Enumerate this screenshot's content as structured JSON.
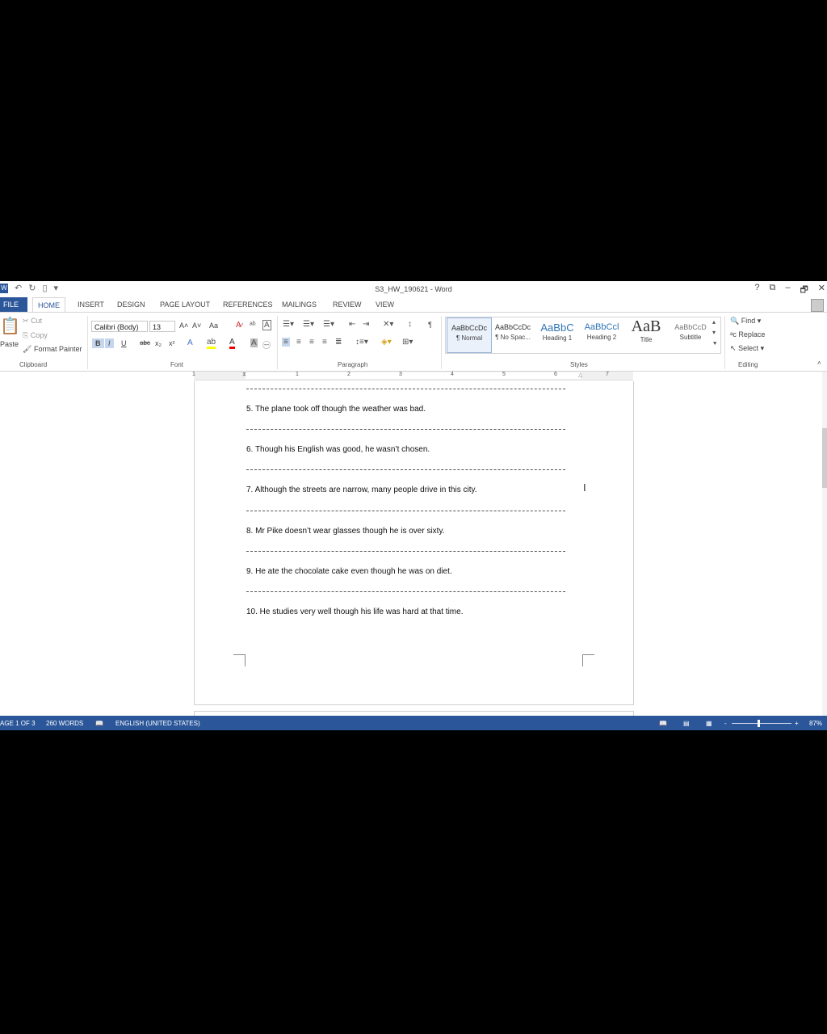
{
  "app": {
    "doc_title": "S3_HW_190621 - Word",
    "help": "?",
    "window_controls": [
      "⧉",
      "–",
      "🗗",
      "✕"
    ]
  },
  "tabs": [
    "FILE",
    "HOME",
    "INSERT",
    "DESIGN",
    "PAGE LAYOUT",
    "REFERENCES",
    "MAILINGS",
    "REVIEW",
    "VIEW"
  ],
  "ribbon": {
    "clipboard": {
      "paste": "Paste",
      "cut": "Cut",
      "copy": "Copy",
      "format_painter": "Format Painter",
      "label": "Clipboard"
    },
    "font": {
      "name": "Calibri (Body)",
      "size": "13",
      "label": "Font",
      "grow": "A˄",
      "shrink": "A˅",
      "case": "Aa",
      "bold": "B",
      "italic": "I",
      "underline": "U",
      "strike": "abc",
      "sub": "x₂",
      "sup": "x²"
    },
    "paragraph": {
      "label": "Paragraph",
      "pilcrow": "¶"
    },
    "styles": {
      "label": "Styles",
      "items": [
        {
          "sample": "AaBbCcDc",
          "name": "¶ Normal"
        },
        {
          "sample": "AaBbCcDc",
          "name": "¶ No Spac..."
        },
        {
          "sample": "AaBbC",
          "name": "Heading 1"
        },
        {
          "sample": "AaBbCcl",
          "name": "Heading 2"
        },
        {
          "sample": "AaB",
          "name": "Title"
        },
        {
          "sample": "AaBbCcD",
          "name": "Subtitle"
        }
      ]
    },
    "editing": {
      "find": "Find",
      "replace": "Replace",
      "select": "Select",
      "label": "Editing"
    }
  },
  "ruler": {
    "numbers": [
      "1",
      "1",
      "2",
      "3",
      "4",
      "5",
      "6",
      "7"
    ]
  },
  "document": {
    "sentences": [
      "5. The plane took off though the weather was bad.",
      "6. Though his English was good, he wasn’t chosen.",
      "7. Although the streets are narrow, many people drive in this city.",
      "8. Mr Pike doesn’t wear glasses though he is over sixty.",
      "9. He ate the chocolate cake even though he was on diet.",
      "10. He studies very well though his life was hard at that time."
    ]
  },
  "status": {
    "page": "AGE 1 OF 3",
    "words": "260 WORDS",
    "language": "ENGLISH (UNITED STATES)",
    "zoom": "87%",
    "zoom_minus": "-",
    "zoom_plus": "+"
  }
}
